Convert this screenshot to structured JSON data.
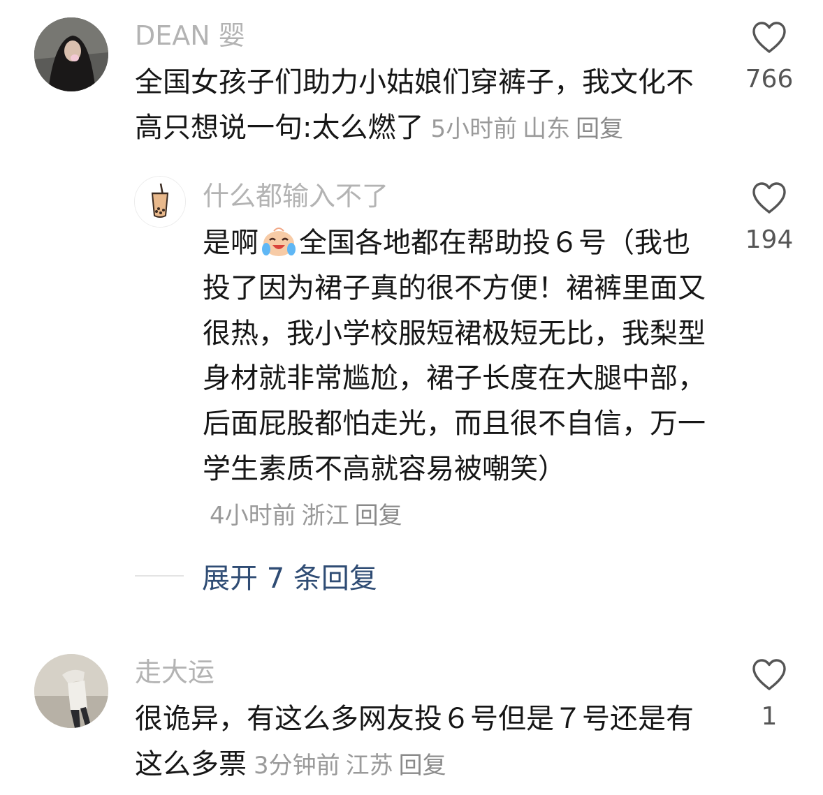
{
  "comments": [
    {
      "username": "DEAN 婴",
      "text": "全国女孩子们助力小姑娘们穿裤子，我文化不高只想说一句:太么燃了",
      "time": "5小时前",
      "location": "山东",
      "reply_label": "回复",
      "likes": "766",
      "avatar_icon": "user-avatar-photo"
    },
    {
      "username": "什么都输入不了",
      "text_before_emoji": "是啊",
      "emoji": "laughing-crying-face-emoji",
      "text_after_emoji": "全国各地都在帮助投６号（我也投了因为裙子真的很不方便！裙裤里面又很热，我小学校服短裙极短无比，我梨型身材就非常尴尬，裙子长度在大腿中部，后面屁股都怕走光，而且很不自信，万一学生素质不高就容易被嘲笑）",
      "time": "4小时前",
      "location": "浙江",
      "reply_label": "回复",
      "likes": "194",
      "avatar_icon": "bubble-tea-avatar"
    },
    {
      "username": "走大运",
      "text": "很诡异，有这么多网友投６号但是７号还是有这么多票",
      "time": "3分钟前",
      "location": "江苏",
      "reply_label": "回复",
      "likes": "1",
      "avatar_icon": "user-avatar-photo"
    }
  ],
  "expand_replies": "展开 7 条回复",
  "colors": {
    "username": "#b3b3b3",
    "text": "#161616",
    "meta": "#9a9a9a",
    "expand_link": "#2f4c74"
  }
}
